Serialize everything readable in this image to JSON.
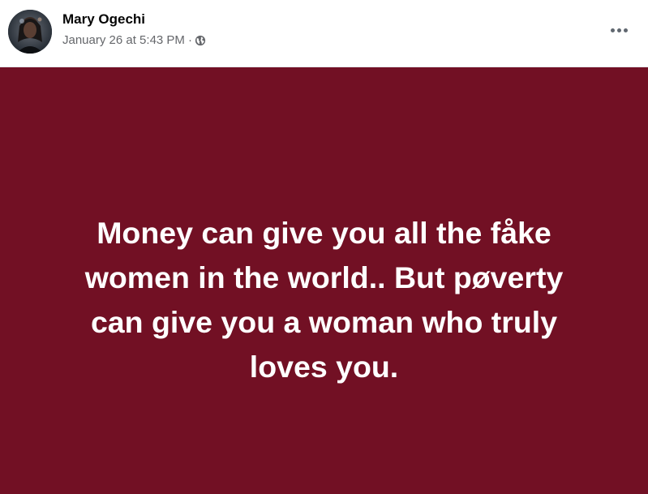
{
  "author": {
    "name": "Mary Ogechi",
    "timestamp": "January 26 at 5:43 PM",
    "separator": "·",
    "audience_icon": "globe-icon"
  },
  "menu": {
    "icon": "more-horizontal-icon"
  },
  "post": {
    "background_color": "#721024",
    "text_color": "#ffffff",
    "lines": [
      "Money can give you all the fåke",
      "women in the world.. But pøverty",
      "can give you a woman who truly",
      "loves you."
    ]
  }
}
